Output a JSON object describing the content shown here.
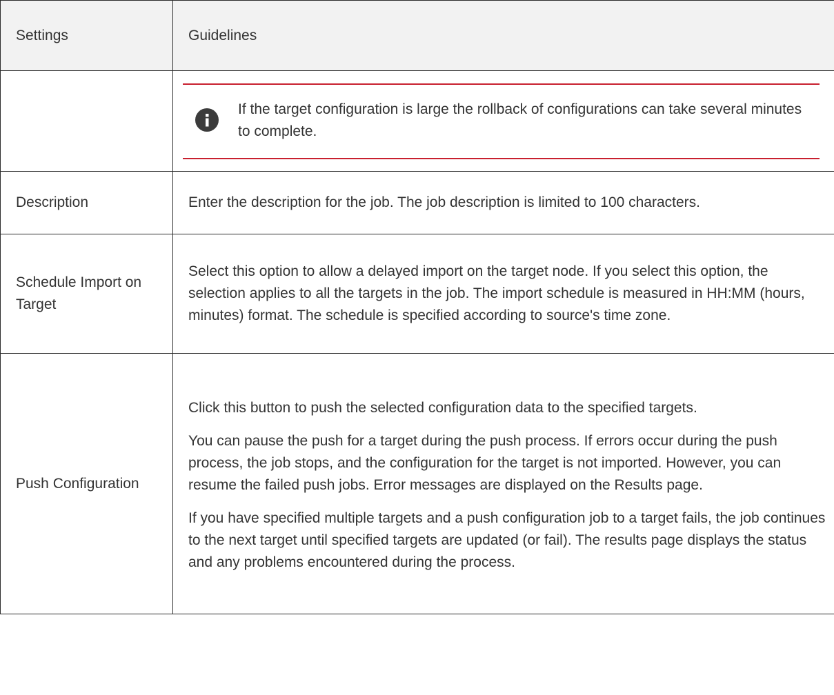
{
  "table": {
    "headers": {
      "settings": "Settings",
      "guidelines": "Guidelines"
    },
    "note": {
      "icon": "info-icon",
      "text": "If the target configuration is large the rollback of configurations can take several minutes to complete.",
      "border_color": "#c8202f"
    },
    "rows": [
      {
        "setting": "Description",
        "guidelines": [
          "Enter the description for the job. The job description is limited to 100 characters."
        ]
      },
      {
        "setting": "Schedule Import on Target",
        "guidelines": [
          "Select this option to allow a delayed import on the target node. If you select this option, the selection applies to all the targets in the job. The import schedule is measured in HH:MM (hours, minutes) format. The schedule is specified according to source's time zone."
        ]
      },
      {
        "setting": "Push Configuration",
        "guidelines": [
          "Click this button to push the selected configuration data to the specified targets.",
          "You can pause the push for a target during the push process. If errors occur during the push process, the job stops, and the configuration for the target is not imported. However, you can resume the failed push jobs. Error messages are displayed on the Results page.",
          "If you have specified multiple targets and a push configuration job to a target fails, the job continues to the next target until specified targets are updated (or fail). The results page displays the status and any problems encountered during the process."
        ]
      }
    ]
  }
}
